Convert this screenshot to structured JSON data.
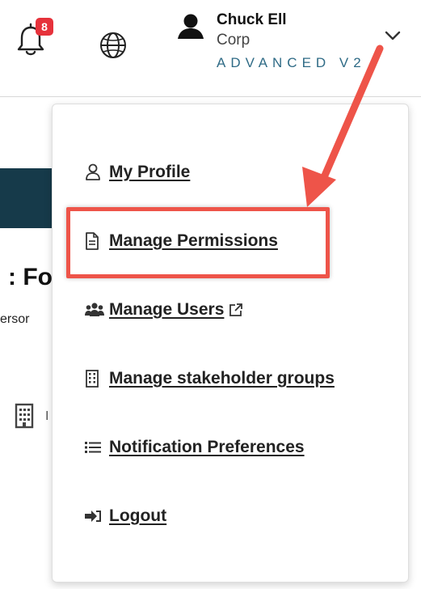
{
  "header": {
    "notifications": {
      "count": "8",
      "icon": "bell-icon"
    },
    "language": {
      "icon": "globe-icon"
    },
    "user": {
      "name": "Chuck Ell",
      "org": "Corp",
      "plan": "ADVANCED V2",
      "avatar_icon": "user-avatar-icon",
      "dropdown_icon": "chevron-down-icon"
    }
  },
  "background": {
    "heading_fragment": ": Fo",
    "subtext_fragment": "ersor"
  },
  "menu": {
    "items": [
      {
        "label": "My Profile",
        "icon": "user-outline-icon"
      },
      {
        "label": "Manage Permissions",
        "icon": "document-icon"
      },
      {
        "label": "Manage Users",
        "icon": "users-icon",
        "external": true
      },
      {
        "label": "Manage stakeholder groups",
        "icon": "building-icon"
      },
      {
        "label": "Notification Preferences",
        "icon": "list-icon"
      },
      {
        "label": "Logout",
        "icon": "logout-icon"
      }
    ]
  },
  "annotation": {
    "color": "#ee5449",
    "highlighted_item": "Manage Permissions"
  },
  "colors": {
    "badge": "#e6323b",
    "plan_text": "#2f6b86",
    "band": "#163a4a"
  }
}
